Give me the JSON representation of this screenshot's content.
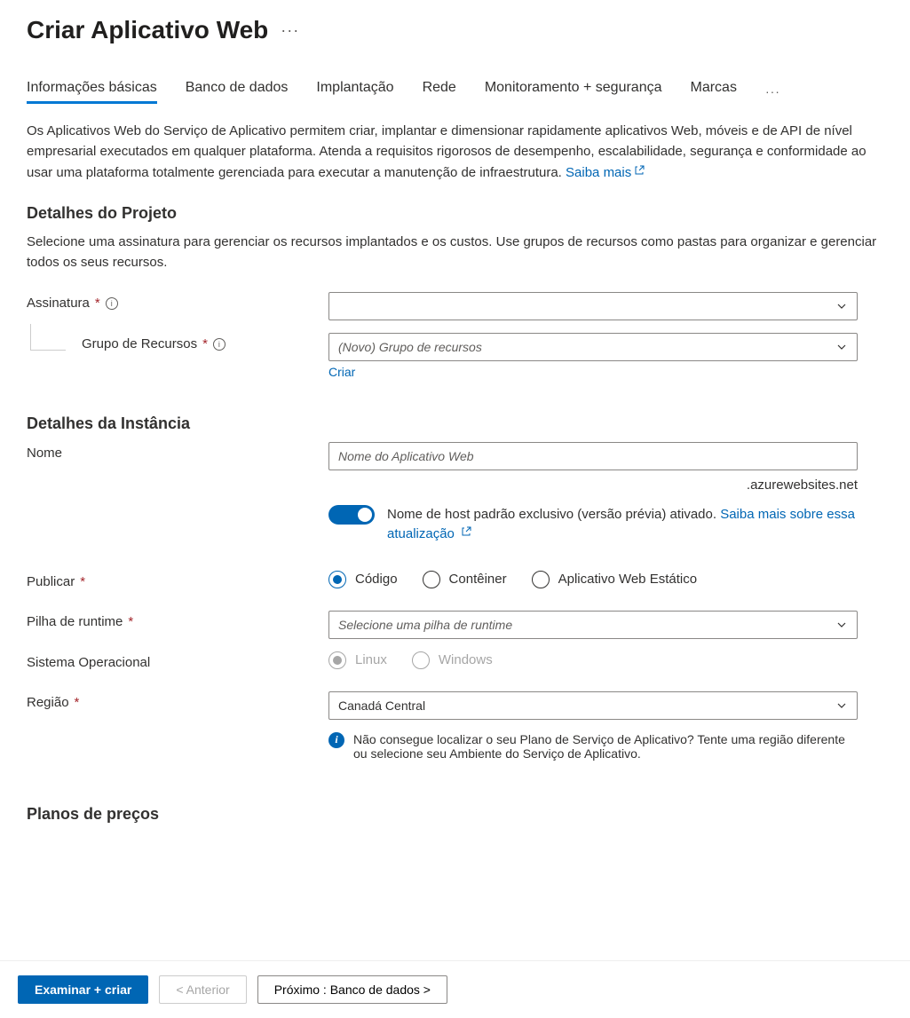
{
  "header": {
    "title": "Criar Aplicativo Web"
  },
  "tabs": {
    "items": [
      "Informações básicas",
      "Banco de dados",
      "Implantação",
      "Rede",
      "Monitoramento + segurança",
      "Marcas"
    ],
    "active": 0
  },
  "intro": {
    "text": "Os Aplicativos Web do Serviço de Aplicativo permitem criar, implantar e dimensionar rapidamente aplicativos Web, móveis e de API de nível empresarial executados em qualquer plataforma. Atenda a requisitos rigorosos de desempenho, escalabilidade, segurança e conformidade ao usar uma plataforma totalmente gerenciada para executar a manutenção de infraestrutura. ",
    "learn_more": "Saiba mais"
  },
  "project": {
    "heading": "Detalhes do Projeto",
    "desc": "Selecione uma assinatura para gerenciar os recursos implantados e os custos. Use grupos de recursos como pastas para organizar e gerenciar todos os seus recursos.",
    "subscription_label": "Assinatura",
    "resource_group_label": "Grupo de Recursos",
    "resource_group_value": "(Novo) Grupo de recursos",
    "create_new": "Criar"
  },
  "instance": {
    "heading": "Detalhes da Instância",
    "name_label": "Nome",
    "name_placeholder": "Nome do Aplicativo Web",
    "suffix": ".azurewebsites.net",
    "hostname_text": "Nome de host padrão exclusivo (versão prévia) ativado. ",
    "hostname_link": "Saiba mais sobre essa atualização",
    "publish_label": "Publicar",
    "publish_options": [
      "Código",
      "Contêiner",
      "Aplicativo Web Estático"
    ],
    "runtime_label": "Pilha de runtime",
    "runtime_placeholder": "Selecione uma pilha de runtime",
    "os_label": "Sistema Operacional",
    "os_options": [
      "Linux",
      "Windows"
    ],
    "region_label": "Região",
    "region_value": "Canadá Central",
    "region_info": "Não consegue localizar o seu Plano de Serviço de Aplicativo? Tente uma região diferente ou selecione seu Ambiente do Serviço de Aplicativo."
  },
  "pricing": {
    "heading": "Planos de preços"
  },
  "footer": {
    "review": "Examinar + criar",
    "previous": "< Anterior",
    "next": "Próximo : Banco de dados >"
  }
}
